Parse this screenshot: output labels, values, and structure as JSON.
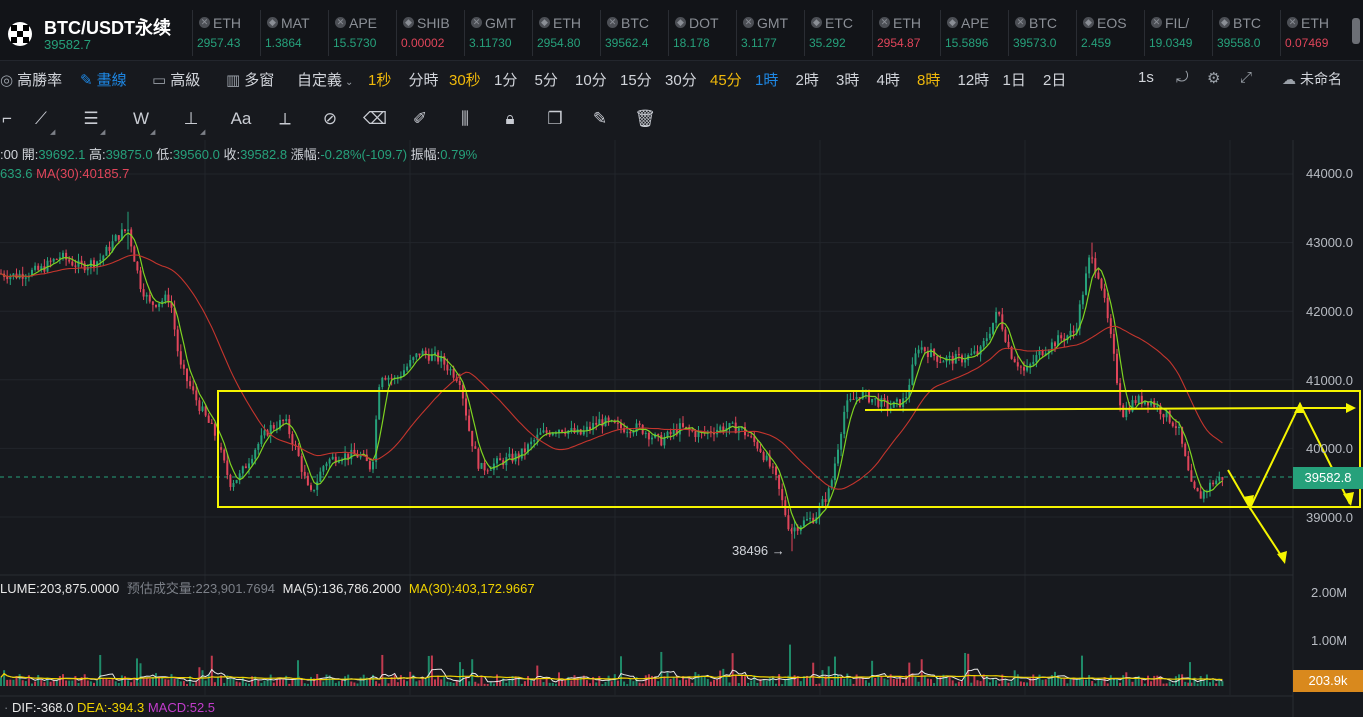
{
  "header": {
    "pair": "BTC/USDT永续",
    "price": "39582.7",
    "tickers": [
      {
        "symbol": "ETH",
        "value": "2957.43",
        "dir": "up"
      },
      {
        "symbol": "MAT",
        "value": "1.3864",
        "dir": "up"
      },
      {
        "symbol": "APE",
        "value": "15.5730",
        "dir": "up"
      },
      {
        "symbol": "SHIB",
        "value": "0.00002",
        "dir": "dn"
      },
      {
        "symbol": "GMT",
        "value": "3.11730",
        "dir": "up"
      },
      {
        "symbol": "ETH",
        "value": "2954.80",
        "dir": "up"
      },
      {
        "symbol": "BTC",
        "value": "39562.4",
        "dir": "up"
      },
      {
        "symbol": "DOT",
        "value": "18.178",
        "dir": "up"
      },
      {
        "symbol": "GMT",
        "value": "3.1177",
        "dir": "up"
      },
      {
        "symbol": "ETC",
        "value": "35.292",
        "dir": "up"
      },
      {
        "symbol": "ETH",
        "value": "2954.87",
        "dir": "dn"
      },
      {
        "symbol": "APE",
        "value": "15.5896",
        "dir": "up"
      },
      {
        "symbol": "BTC",
        "value": "39573.0",
        "dir": "up"
      },
      {
        "symbol": "EOS",
        "value": "2.459",
        "dir": "up"
      },
      {
        "symbol": "FIL/",
        "value": "19.0349",
        "dir": "up"
      },
      {
        "symbol": "BTC",
        "value": "39558.0",
        "dir": "up"
      },
      {
        "symbol": "ETH",
        "value": "0.07469",
        "dir": "dn"
      }
    ]
  },
  "toolbar": {
    "left_items": [
      "高勝率",
      "畫線",
      "高級",
      "多窗",
      "自定義"
    ],
    "intervals": [
      {
        "label": "1秒",
        "style": "orange"
      },
      {
        "label": "分時",
        "style": "normal"
      },
      {
        "label": "30秒",
        "style": "orange"
      },
      {
        "label": "1分",
        "style": "normal"
      },
      {
        "label": "5分",
        "style": "normal"
      },
      {
        "label": "10分",
        "style": "normal"
      },
      {
        "label": "15分",
        "style": "normal"
      },
      {
        "label": "30分",
        "style": "normal"
      },
      {
        "label": "45分",
        "style": "orange"
      },
      {
        "label": "1時",
        "style": "blue"
      },
      {
        "label": "2時",
        "style": "normal"
      },
      {
        "label": "3時",
        "style": "normal"
      },
      {
        "label": "4時",
        "style": "normal"
      },
      {
        "label": "8時",
        "style": "orange"
      },
      {
        "label": "12時",
        "style": "normal"
      },
      {
        "label": "1日",
        "style": "normal"
      },
      {
        "label": "2日",
        "style": "normal"
      }
    ],
    "right_interval": "1s",
    "unnamed": "未命名"
  },
  "ohlc": {
    "time_tail": ":00",
    "open_label": "開:",
    "open": "39692.1",
    "high_label": "高:",
    "high": "39875.0",
    "low_label": "低:",
    "low": "39560.0",
    "close_label": "收:",
    "close": "39582.8",
    "change_label": "漲幅:",
    "change": "-0.28%(-109.7)",
    "amp_label": "振幅:",
    "amp": "0.79%",
    "ma_short": "633.6",
    "ma30": "MA(30):40185.7"
  },
  "axis": {
    "prices": [
      "44000.0",
      "43000.0",
      "42000.0",
      "41000.0",
      "40000.0",
      "39000.0"
    ],
    "last_price": "39582.8",
    "low_annotation": "38496",
    "vol_ticks": [
      "2.00M",
      "1.00M"
    ],
    "last_volume": "203.9k"
  },
  "volume": {
    "label": "LUME:203,875.0000",
    "est": "预估成交量:223,901.7694",
    "ma5": "MA(5):136,786.2000",
    "ma30": "MA(30):403,172.9667"
  },
  "macd": {
    "dif": "DIF:-368.0",
    "dea": "DEA:-394.3",
    "macd": "MACD:52.5"
  },
  "colors": {
    "up": "#26a17b",
    "down": "#e0455a",
    "annotation": "#f5f500",
    "ma30": "#c4352d",
    "ma_short": "#7ed321"
  },
  "chart_data": {
    "type": "candlestick",
    "series_points": [
      [
        0,
        42550
      ],
      [
        15,
        42520
      ],
      [
        40,
        42600
      ],
      [
        60,
        42800
      ],
      [
        80,
        42650
      ],
      [
        100,
        42750
      ],
      [
        118,
        43100
      ],
      [
        128,
        43200
      ],
      [
        140,
        42400
      ],
      [
        150,
        42100
      ],
      [
        170,
        42200
      ],
      [
        180,
        41200
      ],
      [
        200,
        40600
      ],
      [
        215,
        40200
      ],
      [
        230,
        39500
      ],
      [
        240,
        39600
      ],
      [
        255,
        40000
      ],
      [
        270,
        40300
      ],
      [
        285,
        40400
      ],
      [
        298,
        39900
      ],
      [
        310,
        39300
      ],
      [
        325,
        39800
      ],
      [
        340,
        39900
      ],
      [
        360,
        39900
      ],
      [
        372,
        39700
      ],
      [
        380,
        41100
      ],
      [
        395,
        41000
      ],
      [
        420,
        41400
      ],
      [
        440,
        41300
      ],
      [
        460,
        41000
      ],
      [
        470,
        40200
      ],
      [
        480,
        39700
      ],
      [
        500,
        39800
      ],
      [
        520,
        39900
      ],
      [
        540,
        40200
      ],
      [
        560,
        40300
      ],
      [
        580,
        40200
      ],
      [
        600,
        40400
      ],
      [
        620,
        40300
      ],
      [
        640,
        40300
      ],
      [
        660,
        40100
      ],
      [
        680,
        40300
      ],
      [
        700,
        40200
      ],
      [
        720,
        40300
      ],
      [
        740,
        40300
      ],
      [
        760,
        40000
      ],
      [
        775,
        39600
      ],
      [
        790,
        38800
      ],
      [
        800,
        38900
      ],
      [
        815,
        39000
      ],
      [
        830,
        39400
      ],
      [
        845,
        40600
      ],
      [
        860,
        40800
      ],
      [
        875,
        40700
      ],
      [
        890,
        40600
      ],
      [
        905,
        40700
      ],
      [
        918,
        41500
      ],
      [
        940,
        41300
      ],
      [
        960,
        41300
      ],
      [
        980,
        41400
      ],
      [
        998,
        42000
      ],
      [
        1010,
        41400
      ],
      [
        1025,
        41100
      ],
      [
        1040,
        41400
      ],
      [
        1060,
        41600
      ],
      [
        1075,
        41700
      ],
      [
        1090,
        42800
      ],
      [
        1100,
        42500
      ],
      [
        1112,
        41500
      ],
      [
        1122,
        40500
      ],
      [
        1135,
        40700
      ],
      [
        1150,
        40700
      ],
      [
        1165,
        40500
      ],
      [
        1178,
        40300
      ],
      [
        1192,
        39400
      ],
      [
        1200,
        39300
      ],
      [
        1212,
        39500
      ],
      [
        1225,
        39600
      ]
    ],
    "price_range": [
      38300,
      44300
    ],
    "volume_range": [
      0,
      2200000
    ],
    "volume_last": 203875,
    "volume_ma5": 136786.2,
    "volume_ma30": 403172.9667,
    "macd_dif": -368.0,
    "macd_dea": -394.3,
    "macd_hist": 52.5
  }
}
